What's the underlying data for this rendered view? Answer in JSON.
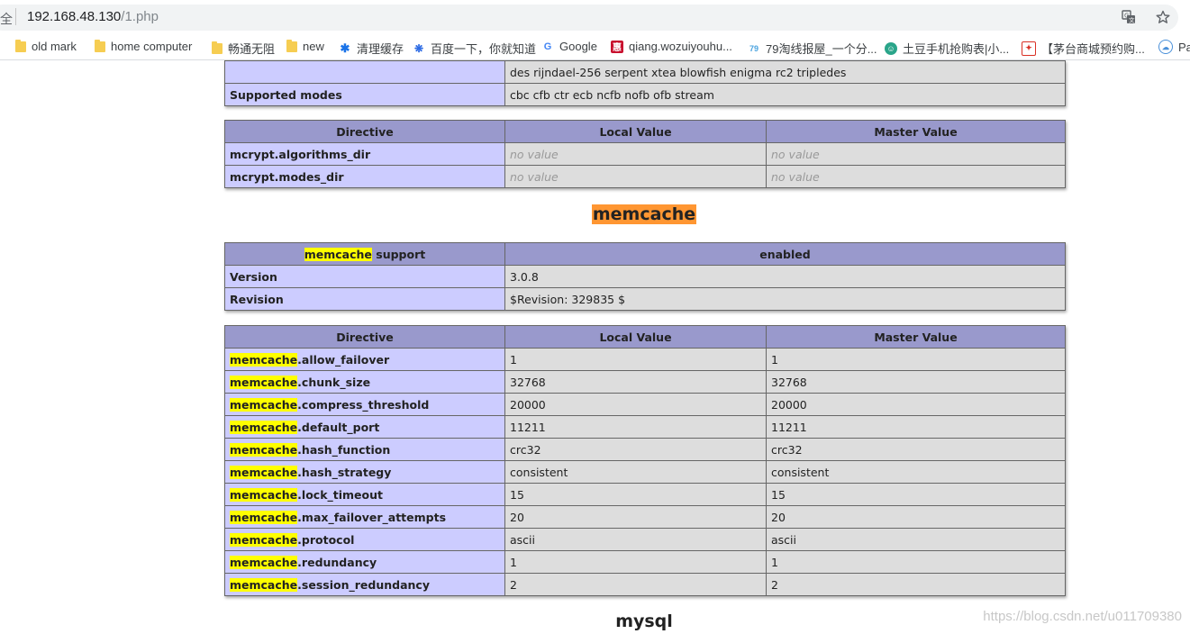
{
  "browser": {
    "security_text": "全",
    "url_host": "192.168.48.130",
    "url_path": "/1.php",
    "translate_icon": "translate-icon",
    "star_icon": "star-icon"
  },
  "bookmarks": [
    {
      "label": "old mark",
      "icon": "folder-icon"
    },
    {
      "label": "home computer",
      "icon": "folder-icon"
    },
    {
      "label": "畅通无阻",
      "icon": "folder-icon"
    },
    {
      "label": "new",
      "icon": "folder-icon"
    },
    {
      "label": "清理缓存",
      "icon": "gear-icon"
    },
    {
      "label": "百度一下，你就知道",
      "icon": "baidu-paw-icon"
    },
    {
      "label": "Google",
      "icon": "google-icon"
    },
    {
      "label": "qiang.wozuiyouhu...",
      "icon": "hui-icon"
    },
    {
      "label": "79淘线报屋_一个分...",
      "icon": "79-icon"
    },
    {
      "label": "土豆手机抢购表|小...",
      "icon": "tudou-icon"
    },
    {
      "label": "【茅台商城预约购...",
      "icon": "maotai-icon"
    },
    {
      "label": "Pa",
      "icon": "cloud-icon"
    }
  ],
  "mcrypt_top": {
    "algorithms_cont": "des rijndael-256 serpent xtea blowfish enigma rc2 tripledes",
    "modes_label": "Supported modes",
    "modes_value": "cbc cfb ctr ecb ncfb nofb ofb stream"
  },
  "mcrypt_directives": {
    "headers": [
      "Directive",
      "Local Value",
      "Master Value"
    ],
    "rows": [
      {
        "name": "mcrypt.algorithms_dir",
        "local": "no value",
        "master": "no value"
      },
      {
        "name": "mcrypt.modes_dir",
        "local": "no value",
        "master": "no value"
      }
    ]
  },
  "memcache": {
    "title": "memcache",
    "support_highlight": "memcache",
    "support_rest": " support",
    "support_value": "enabled",
    "version_label": "Version",
    "version_value": "3.0.8",
    "revision_label": "Revision",
    "revision_value": "$Revision: 329835 $"
  },
  "memcache_directives": {
    "headers": [
      "Directive",
      "Local Value",
      "Master Value"
    ],
    "prefix": "memcache",
    "rows": [
      {
        "suffix": ".allow_failover",
        "local": "1",
        "master": "1"
      },
      {
        "suffix": ".chunk_size",
        "local": "32768",
        "master": "32768"
      },
      {
        "suffix": ".compress_threshold",
        "local": "20000",
        "master": "20000"
      },
      {
        "suffix": ".default_port",
        "local": "11211",
        "master": "11211"
      },
      {
        "suffix": ".hash_function",
        "local": "crc32",
        "master": "crc32"
      },
      {
        "suffix": ".hash_strategy",
        "local": "consistent",
        "master": "consistent"
      },
      {
        "suffix": ".lock_timeout",
        "local": "15",
        "master": "15"
      },
      {
        "suffix": ".max_failover_attempts",
        "local": "20",
        "master": "20"
      },
      {
        "suffix": ".protocol",
        "local": "ascii",
        "master": "ascii"
      },
      {
        "suffix": ".redundancy",
        "local": "1",
        "master": "1"
      },
      {
        "suffix": ".session_redundancy",
        "local": "2",
        "master": "2"
      }
    ]
  },
  "next_section": {
    "title": "mysql"
  },
  "watermark": "https://blog.csdn.net/u011709380",
  "colors": {
    "header_bg": "#9999cc",
    "label_bg": "#ccccff",
    "value_bg": "#dddddd",
    "search_highlight": "#ffff00",
    "search_current": "#ff9632"
  }
}
